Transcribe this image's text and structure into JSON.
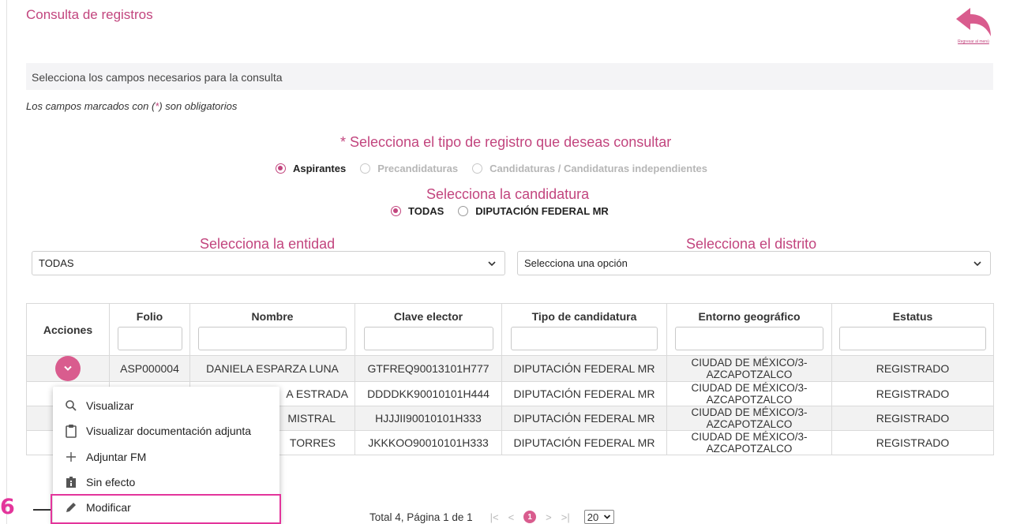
{
  "page": {
    "title": "Consulta de registros",
    "back_label": "Regresar al menú"
  },
  "form": {
    "info_bar": "Selecciona los campos necesarios para la consulta",
    "required_note_pre": "Los campos marcados con (",
    "required_note_star": "*",
    "required_note_post": ") son obligatorios",
    "tipo_title": "* Selecciona el tipo de registro que deseas consultar",
    "tipo_options": [
      {
        "label": "Aspirantes",
        "selected": true,
        "enabled": true
      },
      {
        "label": "Precandidaturas",
        "selected": false,
        "enabled": false
      },
      {
        "label": "Candidaturas / Candidaturas independientes",
        "selected": false,
        "enabled": false
      }
    ],
    "candidatura_title": "Selecciona la candidatura",
    "candidatura_options": [
      {
        "label": "TODAS",
        "selected": true
      },
      {
        "label": "DIPUTACIÓN FEDERAL MR",
        "selected": false
      }
    ],
    "entidad_title": "Selecciona la entidad",
    "entidad_value": "TODAS",
    "distrito_title": "Selecciona el distrito",
    "distrito_value": "Selecciona una opción"
  },
  "table": {
    "headers": [
      "Acciones",
      "Folio",
      "Nombre",
      "Clave elector",
      "Tipo de candidatura",
      "Entorno geográfico",
      "Estatus"
    ],
    "rows": [
      {
        "folio": "ASP000004",
        "nombre": "DANIELA ESPARZA LUNA",
        "clave": "GTFREQ90013101H777",
        "tipo": "DIPUTACIÓN FEDERAL MR",
        "geo1": "CIUDAD DE MÉXICO/3-",
        "geo2": "AZCAPOTZALCO",
        "estatus": "REGISTRADO"
      },
      {
        "folio": "",
        "nombre": "A ESTRADA",
        "clave": "DDDDKK90010101H444",
        "tipo": "DIPUTACIÓN FEDERAL MR",
        "geo1": "CIUDAD DE MÉXICO/3-",
        "geo2": "AZCAPOTZALCO",
        "estatus": "REGISTRADO"
      },
      {
        "folio": "",
        "nombre": "MISTRAL",
        "clave": "HJJJII90010101H333",
        "tipo": "DIPUTACIÓN FEDERAL MR",
        "geo1": "CIUDAD DE MÉXICO/3-",
        "geo2": "AZCAPOTZALCO",
        "estatus": "REGISTRADO"
      },
      {
        "folio": "",
        "nombre": "TORRES",
        "clave": "JKKKOO90010101H333",
        "tipo": "DIPUTACIÓN FEDERAL MR",
        "geo1": "CIUDAD DE MÉXICO/3-",
        "geo2": "AZCAPOTZALCO",
        "estatus": "REGISTRADO"
      }
    ]
  },
  "menu": {
    "items": [
      {
        "label": "Visualizar",
        "icon": "search-icon"
      },
      {
        "label": "Visualizar documentación adjunta",
        "icon": "clipboard-icon"
      },
      {
        "label": "Adjuntar FM",
        "icon": "plus-icon"
      },
      {
        "label": "Sin efecto",
        "icon": "info-icon"
      },
      {
        "label": "Modificar",
        "icon": "pencil-icon"
      }
    ]
  },
  "pager": {
    "summary": "Total 4, Página 1 de 1",
    "first": "|<",
    "prev": "<",
    "current": "1",
    "next": ">",
    "last": ">|",
    "page_size": "20"
  },
  "callout": {
    "number": "6"
  },
  "colors": {
    "accent": "#c2457e",
    "action": "#d95c8e",
    "highlight": "#e3359b"
  }
}
